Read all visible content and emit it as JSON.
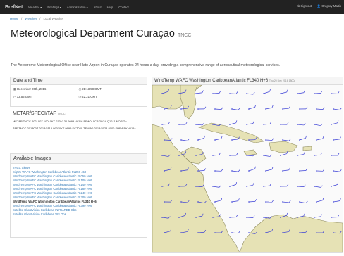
{
  "nav": {
    "brand": "BrefNet",
    "items": [
      "Weather ▾",
      "Briefings ▾",
      "Administration ▾",
      "About",
      "Help",
      "Contact"
    ],
    "right": [
      "⏻ Sign out",
      "👤 Gregory Martis"
    ]
  },
  "breadcrumb": [
    "Home",
    "Weather",
    "Local Weather"
  ],
  "page": {
    "title": "Meteorological Department Curaçao",
    "title_small": "TNCC",
    "lead": "The Aerodrome Meteorological Office near Hato Airport in Curaçao operates 24 hours a day, providing a comprehensive range of aeronautical meteorological services."
  },
  "datetime": {
    "heading": "Date and Time",
    "date": "December 20th, 2016",
    "time_gmt": "21:13:58 GMT",
    "time_local": "13:56 GMT",
    "time_local2": "22:21 GMT"
  },
  "metar": {
    "heading": "METAR/SPECI/TAF",
    "heading_small": "TNCC",
    "metar_text": "METAR TNCC 202100Z 10010KT 070V130 9999 VCSH FEW010CB 28/24 Q1011 NOSIG=",
    "taf_text": "TAF TNCC 201800Z 2018/2118 09010KT 9999 SCT020 TEMPO 2018/2024 8000 SHRA BKN015="
  },
  "images": {
    "heading": "Available Images",
    "items": [
      "TNCC SigWx",
      "SigWx WAFC Washington CaribbeanAtlantic FL250-450",
      "WindTemp WAFC Washington CaribbeanAtlantic FL050 H+6",
      "WindTemp WAFC Washington CaribbeanAtlantic FL100 H+6",
      "WindTemp WAFC Washington CaribbeanAtlantic FL140 H+6",
      "WindTemp WAFC Washington CaribbeanAtlantic FL180 H+6",
      "WindTemp WAFC Washington CaribbeanAtlantic FL240 H+6",
      "WindTemp WAFC Washington CaribbeanAtlantic FL300 H+6",
      "WindTemp WAFC Washington CaribbeanAtlantic FL340 H+6",
      "WindTemp WAFC Washington CaribbeanAtlantic FL390 H+6",
      "Satellite GhostVision Caribbean INFRARED Obs",
      "Satellite GhostVision Caribbean VIS Obs"
    ],
    "active_index": 8
  },
  "chart_panel": {
    "title": "WindTemp WAFC Washington CaribbeanAtlantic FL340 H+6",
    "title_small": "Thu 20 Dec 2016 1800z"
  },
  "colors": {
    "navbar": "#222222",
    "link": "#337ab7",
    "land": "#e6e2b5",
    "barb": "#3a3fd6"
  }
}
